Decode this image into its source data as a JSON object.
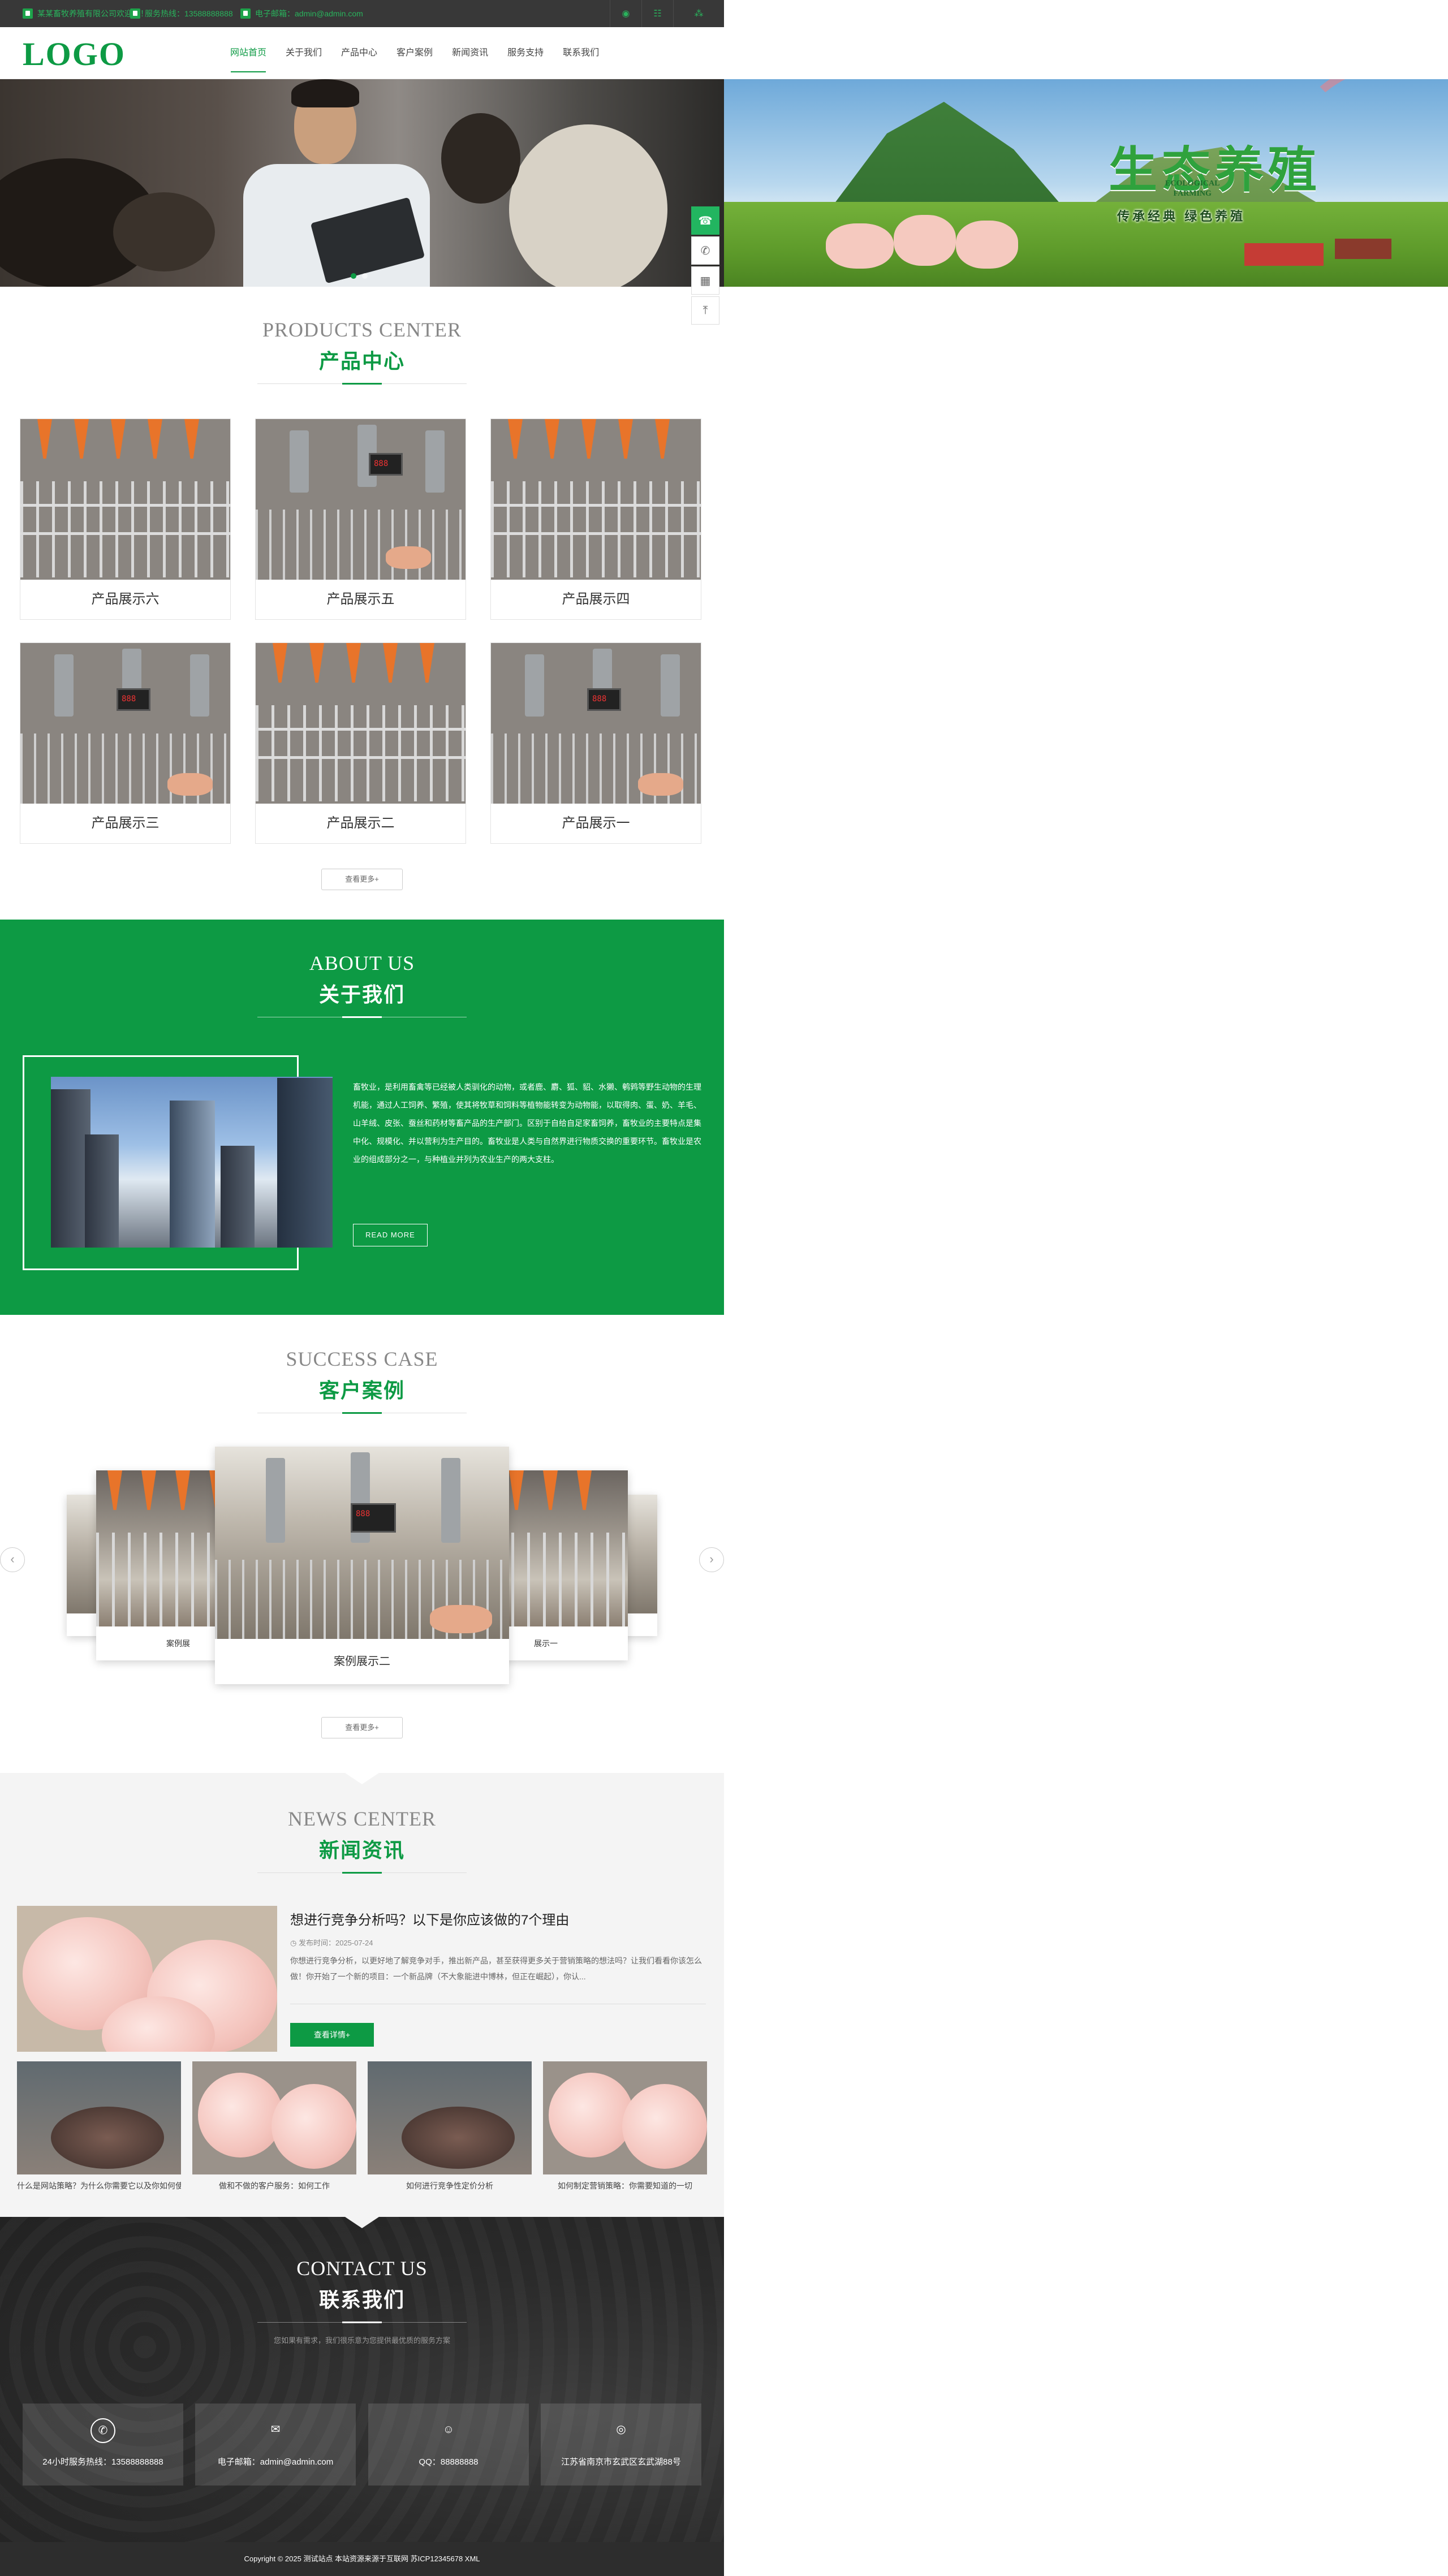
{
  "topbar": {
    "company": "某某畜牧养殖有限公司欢迎您！",
    "phone_label": "服务热线：13588888888",
    "email_label": "电子邮箱：admin@admin.com",
    "icons": [
      "location-icon",
      "wechat-icon",
      "share-icon"
    ]
  },
  "header": {
    "logo": "LOGO",
    "nav": [
      "网站首页",
      "关于我们",
      "产品中心",
      "客户案例",
      "新闻资讯",
      "服务支持",
      "联系我们"
    ],
    "active_nav": 0
  },
  "banner": {
    "slides": 2,
    "active_slide": 0,
    "right_title": "生态养殖",
    "right_eco_line1": "ECOLOGICAL",
    "right_eco_line2": "FARMING",
    "right_slogan": "传承经典 绿色养殖"
  },
  "products": {
    "title_en": "PRODUCTS CENTER",
    "title_cn": "产品中心",
    "items": [
      "产品展示六",
      "产品展示五",
      "产品展示四",
      "产品展示三",
      "产品展示二",
      "产品展示一"
    ],
    "more_label": "查看更多+"
  },
  "about": {
    "title_en": "ABOUT US",
    "title_cn": "关于我们",
    "text": "畜牧业，是利用畜禽等已经被人类驯化的动物，或者鹿、麝、狐、貂、水獭、鹌鹑等野生动物的生理机能，通过人工饲养、繁殖，使其将牧草和饲料等植物能转变为动物能，以取得肉、蛋、奶、羊毛、山羊绒、皮张、蚕丝和药材等畜产品的生产部门。区别于自给自足家畜饲养，畜牧业的主要特点是集中化、规模化、并以营利为生产目的。畜牧业是人类与自然界进行物质交换的重要环节。畜牧业是农业的组成部分之一，与种植业并列为农业生产的两大支柱。",
    "btn_label": "READ MORE"
  },
  "cases": {
    "title_en": "SUCCESS CASE",
    "title_cn": "客户案例",
    "center_caption": "案例展示二",
    "left_caption": "案例展",
    "right_caption": "展示一",
    "more_label": "查看更多+"
  },
  "news": {
    "title_en": "NEWS CENTER",
    "title_cn": "新闻资讯",
    "featured": {
      "title": "想进行竞争分析吗？以下是你应该做的7个理由",
      "date": "发布时间：2025-07-24",
      "summary": "你想进行竞争分析，以更好地了解竞争对手，推出新产品，甚至获得更多关于营销策略的想法吗？让我们看看你该怎么做！你开始了一个新的项目：一个新品牌（不大象能进中博林，但正在崛起），你认...",
      "btn_label": "查看详情+"
    },
    "list": [
      "什么是网站策略？为什么你需要它以及你如何使用",
      "做和不做的客户服务：如何工作",
      "如何进行竞争性定价分析",
      "如何制定营销策略：你需要知道的一切"
    ]
  },
  "contact": {
    "title_en": "CONTACT US",
    "title_cn": "联系我们",
    "subtitle": "您如果有需求，我们很乐意为您提供最优质的服务方案",
    "items": [
      {
        "icon": "phone-24-icon",
        "text": "24小时服务热线：13588888888"
      },
      {
        "icon": "mail-icon",
        "text": "电子邮箱：admin@admin.com"
      },
      {
        "icon": "qq-icon",
        "text": "QQ：88888888"
      },
      {
        "icon": "location-icon",
        "text": "江苏省南京市玄武区玄武湖88号"
      }
    ]
  },
  "footer": {
    "text": "Copyright © 2025 测试站点 本站资源来源于互联网 苏ICP12345678 XML"
  },
  "floating": [
    "service-icon",
    "phone-icon",
    "qrcode-icon",
    "top-icon"
  ],
  "colors": {
    "primary": "#0d9a44",
    "topbar": "#383838",
    "contact_bg": "#262626"
  }
}
